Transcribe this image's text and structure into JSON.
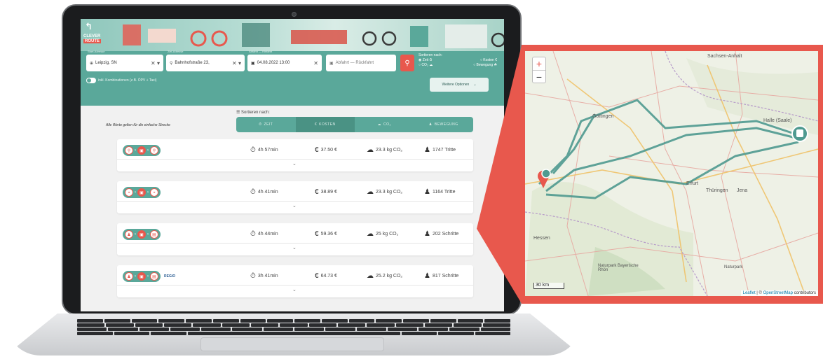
{
  "app": {
    "logo_line1": "CLEVER",
    "logo_line2": "ROUTE",
    "from_label": "Start-Adresse",
    "from_value": "Leipzig, SN",
    "to_label": "Ziel-Adresse",
    "to_value": "Bahnhofstraße 23,",
    "depart_label": "Abfahrt — Hinfahrt",
    "depart_value": "04.08.2022 13:00",
    "return_value": "Abfahrt — Rückfahrt",
    "combo_toggle": "inkl. Kombinationen (z.B. ÖPV + Taxi)",
    "more_options": "Weitere Optionen",
    "sort_title": "Sortieren nach:",
    "sort_opts": [
      "Zeit",
      "Kosten",
      "CO₂",
      "Bewegung"
    ]
  },
  "results": {
    "note": "Alle Werte gelten für die einfache Strecke",
    "sort_head": "Sortieren nach:",
    "tabs": [
      "ZEIT",
      "KOSTEN",
      "CO₂",
      "BEWEGUNG"
    ],
    "active_tab": "KOSTEN",
    "rows": [
      {
        "modes": [
          "bike",
          "train",
          "bike"
        ],
        "time": "4h 57min",
        "cost": "37.50 €",
        "co2": "23.3 kg CO₂",
        "move": "1747 Tritte"
      },
      {
        "modes": [
          "car",
          "train",
          "car"
        ],
        "time": "4h 41min",
        "cost": "38.89 €",
        "co2": "23.3 kg CO₂",
        "move": "1164 Tritte"
      },
      {
        "modes": [
          "walk",
          "train",
          "bus"
        ],
        "time": "4h 44min",
        "cost": "59.36 €",
        "co2": "25 kg CO₂",
        "move": "202 Schritte"
      },
      {
        "modes": [
          "walk",
          "train",
          "bus"
        ],
        "time": "3h 41min",
        "cost": "64.73 €",
        "co2": "25.2 kg CO₂",
        "move": "817 Schritte",
        "badge": "REGIO"
      }
    ]
  },
  "map": {
    "zoom_in": "+",
    "zoom_out": "−",
    "places": [
      "Sachsen-Anhalt",
      "Göttingen",
      "Halle (Saale)",
      "Erfurt",
      "Thüringen",
      "Jena",
      "Hessen",
      "Naturpark Bayerische Rhön",
      "Naturpark"
    ],
    "scale": "30 km",
    "attribution_leaflet": "Leaflet",
    "attribution_osm": "OpenStreetMap",
    "attribution_rest": "contributors",
    "route_color": "#4f9a90",
    "origin_color": "#e8584d"
  },
  "colors": {
    "teal": "#5aa89a",
    "accent": "#e8584d"
  }
}
